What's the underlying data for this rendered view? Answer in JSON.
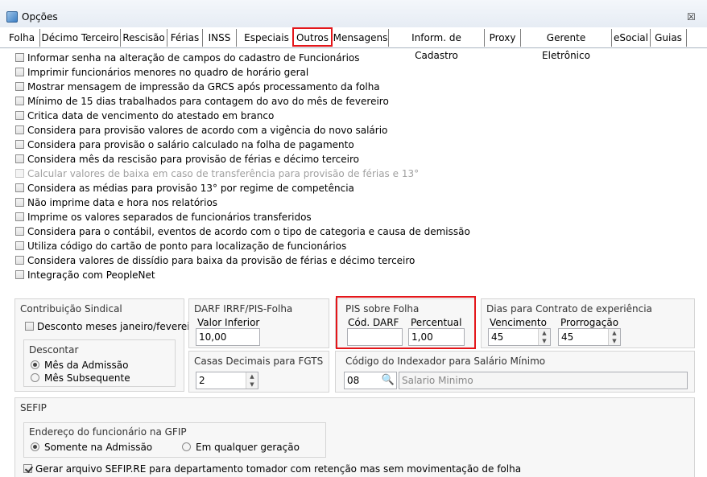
{
  "window": {
    "title": "Opções",
    "close_glyph": "☒"
  },
  "tabs": [
    "Folha",
    "Décimo Terceiro",
    "Rescisão",
    "Férias",
    "INSS",
    "Especiais",
    "Outros",
    "Mensagens",
    "Inform. de Cadastro",
    "Proxy",
    "Gerente Eletrônico",
    "eSocial",
    "Guias"
  ],
  "active_tab": "Outros",
  "options": [
    {
      "label": "Informar senha na alteração de campos do cadastro de Funcionários",
      "checked": false,
      "enabled": true
    },
    {
      "label": "Imprimir funcionários menores no quadro de horário geral",
      "checked": false,
      "enabled": true
    },
    {
      "label": "Mostrar mensagem de impressão da GRCS após processamento da folha",
      "checked": false,
      "enabled": true
    },
    {
      "label": "Mínimo de 15 dias trabalhados para contagem do avo do mês de fevereiro",
      "checked": false,
      "enabled": true
    },
    {
      "label": "Critica data de vencimento do atestado em branco",
      "checked": false,
      "enabled": true
    },
    {
      "label": "Considera para provisão valores de acordo com a vigência do novo salário",
      "checked": false,
      "enabled": true
    },
    {
      "label": "Considera para provisão o salário calculado na folha de pagamento",
      "checked": false,
      "enabled": true
    },
    {
      "label": "Considera mês da rescisão para provisão de férias e décimo terceiro",
      "checked": false,
      "enabled": true
    },
    {
      "label": "Calcular valores de baixa em caso de transferência para provisão de férias e 13°",
      "checked": false,
      "enabled": false
    },
    {
      "label": "Considera as médias para provisão 13° por regime de competência",
      "checked": false,
      "enabled": true
    },
    {
      "label": "Não imprime data e hora nos relatórios",
      "checked": false,
      "enabled": true
    },
    {
      "label": "Imprime os valores separados de funcionários transferidos",
      "checked": false,
      "enabled": true
    },
    {
      "label": "Considera para o contábil, eventos de acordo com o tipo de categoria e causa de demissão",
      "checked": false,
      "enabled": true
    },
    {
      "label": "Utiliza código do cartão de ponto para localização de funcionários",
      "checked": false,
      "enabled": true
    },
    {
      "label": "Considera valores de dissídio para baixa da provisão de férias e décimo terceiro",
      "checked": false,
      "enabled": true
    },
    {
      "label": "Integração com PeopleNet",
      "checked": false,
      "enabled": true
    }
  ],
  "contribuicao": {
    "title": "Contribuição Sindical",
    "desconto_label": "Desconto meses janeiro/fevereiro",
    "descontar_title": "Descontar",
    "opt1": "Mês da Admissão",
    "opt2": "Mês Subsequente",
    "selected": "Mês da Admissão"
  },
  "darf": {
    "title": "DARF IRRF/PIS-Folha",
    "valor_label": "Valor Inferior",
    "valor": "10,00"
  },
  "casas": {
    "title": "Casas Decimais para FGTS",
    "value": "2"
  },
  "pis": {
    "title": "PIS sobre Folha",
    "cod_label": "Cód. DARF",
    "cod_value": "",
    "perc_label": "Percentual",
    "perc_value": "1,00"
  },
  "dias": {
    "title": "Dias para Contrato de experiência",
    "venc_label": "Vencimento",
    "venc_value": "45",
    "prorr_label": "Prorrogação",
    "prorr_value": "45"
  },
  "indexador": {
    "title": "Código do Indexador para Salário Mínimo",
    "code": "08",
    "desc": "Salario Minimo"
  },
  "sefip": {
    "title": "SEFIP",
    "endereco_title": "Endereço do funcionário na GFIP",
    "opt1": "Somente na Admissão",
    "opt2": "Em qualquer geração",
    "selected": "Somente na Admissão",
    "gerar_label": "Gerar arquivo SEFIP.RE para departamento tomador com retenção mas sem movimentação de folha",
    "gerar_checked": true
  },
  "colors": {
    "highlight": "#e4161a",
    "panel": "#f7f7f7",
    "border": "#d5d5d5"
  }
}
